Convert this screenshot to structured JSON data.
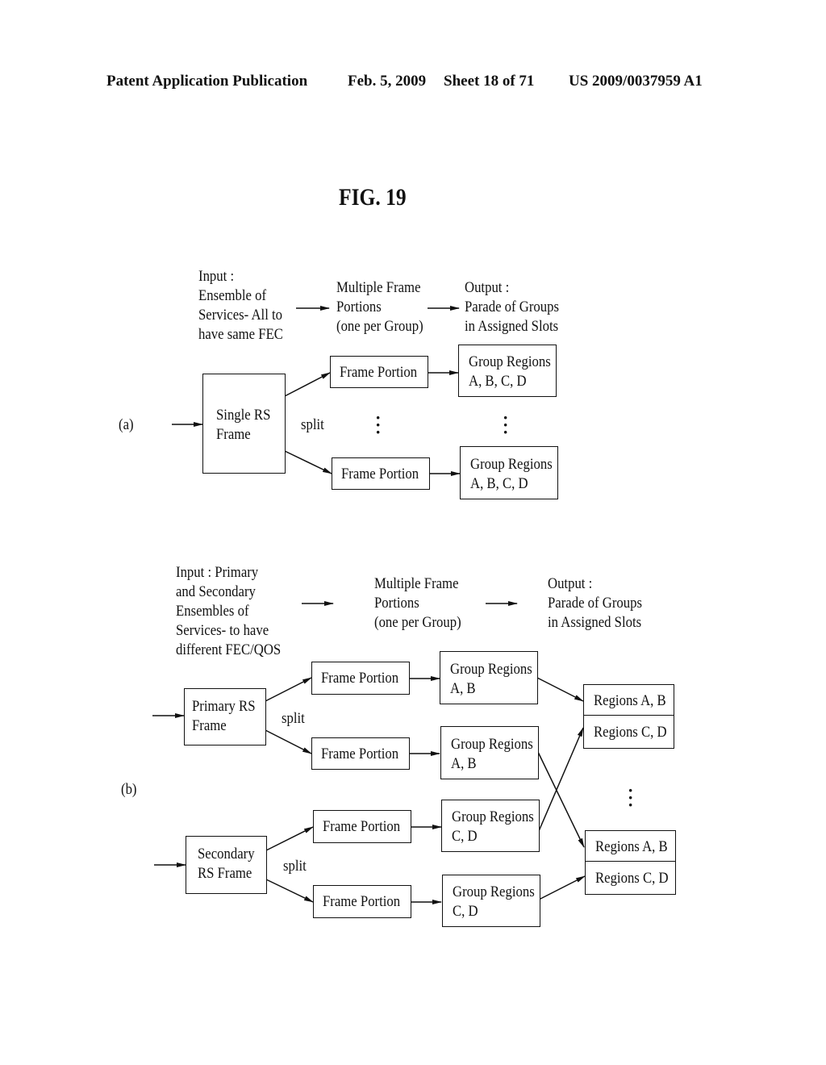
{
  "header": {
    "publication": "Patent Application Publication",
    "date": "Feb. 5, 2009",
    "sheet": "Sheet 18 of 71",
    "number": "US 2009/0037959 A1"
  },
  "figure_title": "FIG. 19",
  "part_a": {
    "label": "(a)",
    "input_text": "Input :\nEnsemble of\nServices- All to\nhave same FEC",
    "middle_text": "Multiple Frame\nPortions\n(one per Group)",
    "output_text": "Output :\nParade of Groups\nin Assigned Slots",
    "source_box": "Single RS\nFrame",
    "split_label": "split",
    "frame_portions": [
      "Frame Portion",
      "Frame Portion"
    ],
    "group_regions": [
      "Group Regions\nA, B, C, D",
      "Group Regions\nA, B, C, D"
    ]
  },
  "part_b": {
    "label": "(b)",
    "input_text": "Input : Primary\nand Secondary\nEnsembles of\nServices- to have\ndifferent FEC/QOS",
    "middle_text": "Multiple Frame\nPortions\n(one per Group)",
    "output_text": "Output :\nParade of Groups\nin Assigned Slots",
    "primary_box": "Primary RS\nFrame",
    "secondary_box": "Secondary\nRS Frame",
    "split_label": "split",
    "frame_portions": [
      "Frame Portion",
      "Frame Portion",
      "Frame Portion",
      "Frame Portion"
    ],
    "group_regions": [
      "Group Regions\nA, B",
      "Group Regions\nA, B",
      "Group Regions\nC, D",
      "Group Regions\nC, D"
    ],
    "slot_top": [
      "Regions A, B",
      "Regions C, D"
    ],
    "slot_bottom": [
      "Regions A, B",
      "Regions C, D"
    ]
  }
}
